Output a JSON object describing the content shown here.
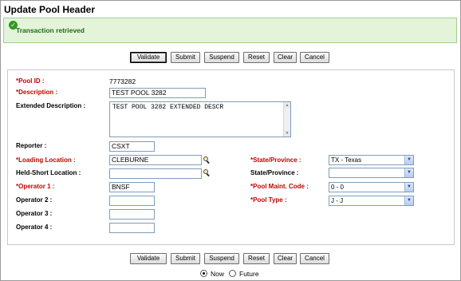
{
  "page": {
    "title": "Update Pool Header"
  },
  "message": {
    "icon": "checkmark-circle-icon",
    "text": "Transaction retrieved",
    "color": "#1e6a12"
  },
  "toolbar": {
    "validate": "Validate",
    "submit": "Submit",
    "suspend": "Suspend",
    "reset": "Reset",
    "clear": "Clear",
    "cancel": "Cancel"
  },
  "form": {
    "pool_id": {
      "label": "*Pool ID :",
      "value": "7773282"
    },
    "description": {
      "label": "*Description :",
      "value": "TEST POOL 3282"
    },
    "extended_description": {
      "label": "Extended Description :",
      "value": "TEST POOL 3282 EXTENDED DESCR"
    },
    "reporter": {
      "label": "Reporter :",
      "value": "CSXT"
    },
    "loading_location": {
      "label": "*Loading Location :",
      "value": "CLEBURNE",
      "icon": "search-icon"
    },
    "held_short_location": {
      "label": "Held-Short Location :",
      "value": "",
      "icon": "search-icon"
    },
    "operator_1": {
      "label": "*Operator 1 :",
      "value": "BNSF"
    },
    "operator_2": {
      "label": "Operator 2 :",
      "value": ""
    },
    "operator_3": {
      "label": "Operator 3 :",
      "value": ""
    },
    "operator_4": {
      "label": "Operator 4 :",
      "value": ""
    },
    "state_province_1": {
      "label": "*State/Province :",
      "value": "TX - Texas"
    },
    "state_province_2": {
      "label": "State/Province :",
      "value": ""
    },
    "pool_maint_code": {
      "label": "*Pool Maint. Code :",
      "value": "0 - 0"
    },
    "pool_type": {
      "label": "*Pool Type :",
      "value": "J - J"
    }
  },
  "mode": {
    "now": {
      "label": "Now",
      "checked": true
    },
    "future": {
      "label": "Future",
      "checked": false
    }
  },
  "colors": {
    "required_label": "#c40000",
    "message_bg": "#e3f4da",
    "message_border": "#9fd18b"
  }
}
